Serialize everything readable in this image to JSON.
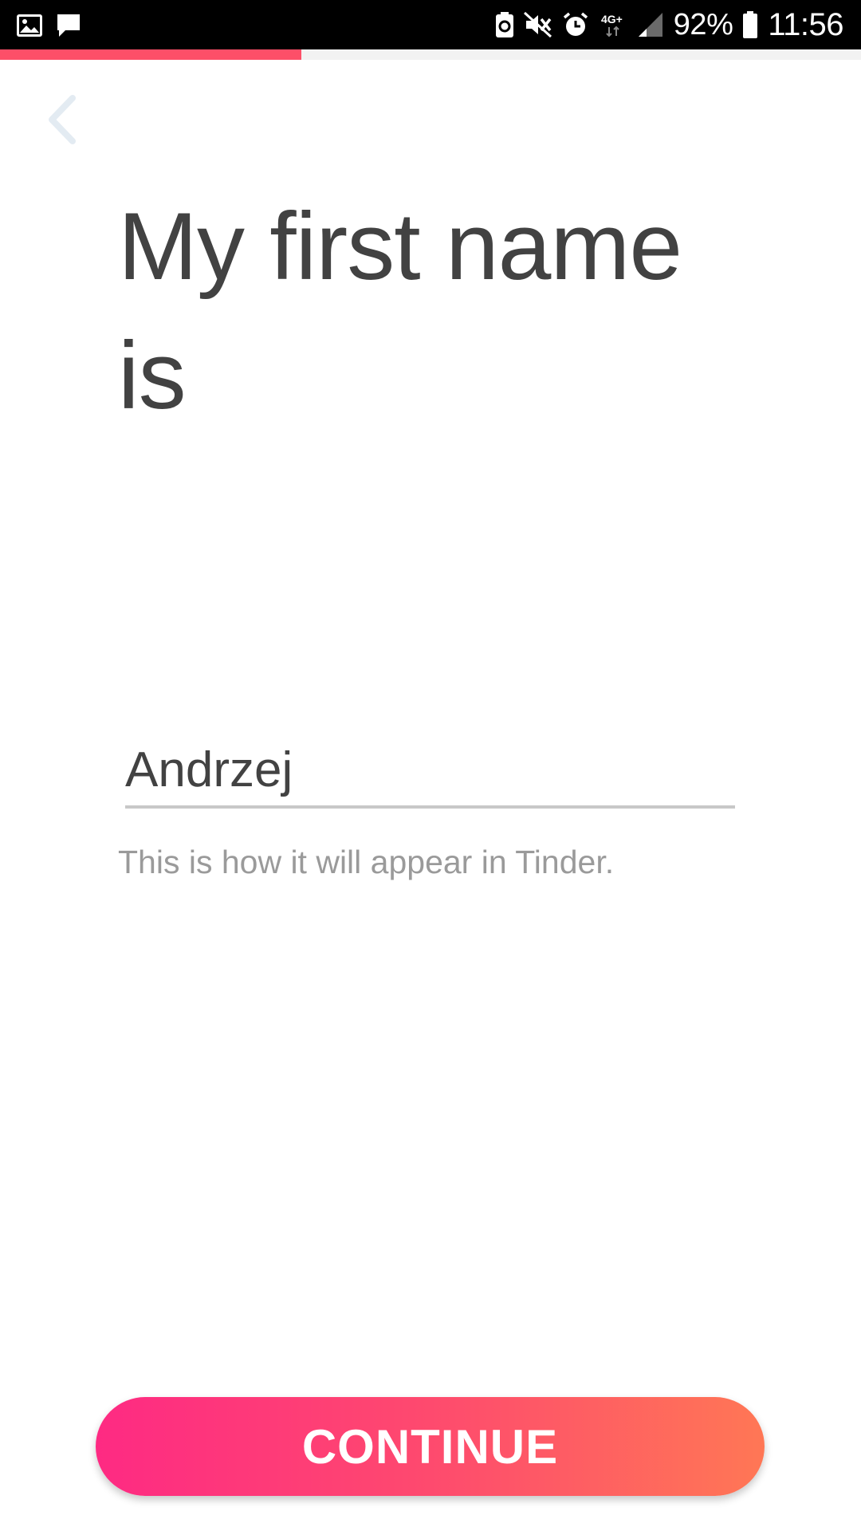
{
  "status_bar": {
    "left_icons": [
      "gallery-icon",
      "message-icon"
    ],
    "right_icons": [
      "battery-saver-icon",
      "mute-icon",
      "alarm-icon",
      "network-4g-icon",
      "signal-icon",
      "battery-icon"
    ],
    "network_label": "4G+",
    "battery_percent": "92%",
    "time": "11:56"
  },
  "progress": {
    "fraction": 0.35,
    "color": "#fd4f68"
  },
  "back_icon": "chevron-left-icon",
  "title": "My first name is",
  "name_input": {
    "value": "Andrzej",
    "placeholder": ""
  },
  "helper_text": "This is how it will appear in Tinder.",
  "continue_label": "CONTINUE",
  "colors": {
    "accent_start": "#fe2a83",
    "accent_end": "#ff7755",
    "title": "#424242",
    "helper": "#9a9a9a",
    "back_icon": "#e3ebf2"
  }
}
